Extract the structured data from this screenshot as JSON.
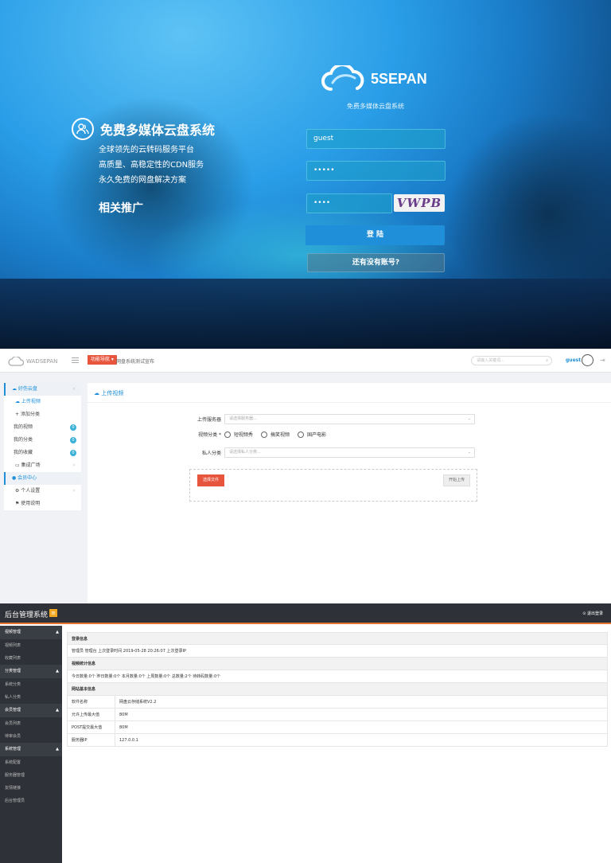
{
  "login": {
    "brand_name": "5SEPAN",
    "subtitle": "免费多媒体云盘系统",
    "promo_title": "免费多媒体云盘系统",
    "promo_lines": [
      "全球领先的云转码服务平台",
      "高质量、高稳定性的CDN服务",
      "永久免费的网盘解决方案"
    ],
    "promo_more": "相关推广",
    "username_value": "guest",
    "password_value": "•••••",
    "captcha_input_value": "••••",
    "captcha_text": "VWPB",
    "login_button": "登 陆",
    "register_button": "还有没有账号?"
  },
  "upload": {
    "logo_text": "WADSEPAN",
    "tag": "功能导航 ▾",
    "notice": "网盘系统测试宣布",
    "search_placeholder": "请输入关键词...",
    "username": "guest",
    "sidebar": {
      "group1": "好伤云盘",
      "items1": [
        {
          "label": "上传视频",
          "active": true
        },
        {
          "label": "添加分类"
        },
        {
          "label": "我的视频",
          "badge": "0"
        },
        {
          "label": "我的分类",
          "badge": "0"
        },
        {
          "label": "我的收藏",
          "badge": "0"
        },
        {
          "label": "集成广场"
        }
      ],
      "group2": "会员中心",
      "items2": [
        {
          "label": "个人设置"
        },
        {
          "label": "使用说明"
        }
      ]
    },
    "page_heading": "上传视频",
    "server_label": "上传服务器",
    "server_placeholder": "请选择服务器...",
    "category_label": "视频分类",
    "category_options": [
      "短视频秀",
      "搞笑视频",
      "国产电影"
    ],
    "private_label": "私人分类",
    "private_placeholder": "请选择私人分类...",
    "choose_file": "选择文件",
    "start_upload": "开始上传"
  },
  "admin": {
    "title": "后台管理系统",
    "logout": "⊙ 退出登录",
    "sidebar": [
      {
        "group": "视频管理",
        "items": [
          "视频列表",
          "收藏列表"
        ]
      },
      {
        "group": "分类管理",
        "items": [
          "系统分类",
          "私人分类"
        ]
      },
      {
        "group": "会员管理",
        "items": [
          "会员列表",
          "待审会员"
        ]
      },
      {
        "group": "系统管理",
        "items": [
          "系统配置",
          "服务器管理",
          "友情链接",
          "后台管理员"
        ]
      }
    ],
    "login_info_header": "登录信息",
    "login_info_text": "管理员 管理台 上次登录时间 2019-05-28 20:26:07 上次登录IP",
    "stats_header": "视频统计信息",
    "stats_text": "今日数量:0个 昨日数量:0个 本月数量:0个 上周数量:0个 总数量:2个 待转码数量:0个",
    "site_header": "网站基本信息",
    "site_rows": [
      {
        "key": "软件名称",
        "value": "网盘云存储系统V2.2"
      },
      {
        "key": "允许上传最大值",
        "value": "80M"
      },
      {
        "key": "POST提交最大值",
        "value": "80M"
      },
      {
        "key": "服务器IP",
        "value": "127.0.0.1"
      }
    ]
  }
}
